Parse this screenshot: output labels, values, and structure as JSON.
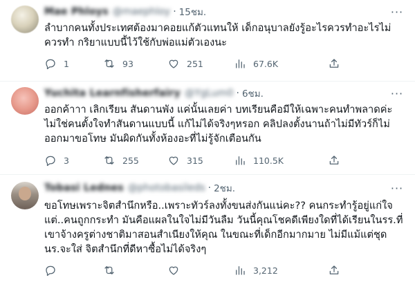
{
  "tweets": [
    {
      "display_name": "Mae Phloys",
      "handle": "@maephloy",
      "time": "15ชม.",
      "text": "ลำบากคนทั้งประเทศต้องมาคอยแก้ตัวแทนให้ เด็กอนุบาลยังรู้อะไรควรทำอะไรไม่ควรทำ กริยาแบบนี้ไว้ใช้กับพ่อแม่ตัวเองนะ",
      "replies": "1",
      "retweets": "93",
      "likes": "251",
      "views": "67.6K"
    },
    {
      "display_name": "Yuchita Learnfisherfairy",
      "handle": "@YgLum0",
      "time": "6ชม.",
      "text": "ออกค้าาา เลิกเรียน สันดานพัง แค่นั้นเลยค่า บทเรียนคือมีให้เฉพาะคนทำพลาดค่ะ ไม่ใช่คนตั้งใจทำสันดานแบบนี้ แก้ไม่ได้จริงๆหรอก คลิปลงตั้งนานถ้าไม่มีทัวร์ก็ไม่ออกมาขอโทษ มันผิดกันทั้งห้องอะที่ไม่รู้จักเตือนกัน",
      "replies": "3",
      "retweets": "255",
      "likes": "315",
      "views": "110.5K"
    },
    {
      "display_name": "Tobasi Lednes",
      "handle": "@photobasileds",
      "time": "2ชม.",
      "text": "ขอโทษเพราะจิตสำนึกหรือ..เพราะทัวร์ลงทั้งขนส่งกันแน่คะ?? คนกระทำรู้อยู่แก่ใจแต่..คนถูกกระทำ มันคือแผลในใจไม่มีวันลืม วันนี้คุณโชคดีเพียงใดที่ได้เรียนในรร.ที่เขาจ้างครูต่างชาติมาสอนสำเนียงให้คุณ ในขณะที่เด็กอีกมากมาย ไม่มีแม้แต่ชุดนร.จะใส่ จิตสำนึกที่ดีหาซื้อไม่ได้จริงๆ",
      "replies": "",
      "retweets": "",
      "likes": "",
      "views": "3,212"
    }
  ],
  "ui": {
    "dot": "·",
    "more": "···"
  },
  "icons": [
    "reply-icon",
    "retweet-icon",
    "like-icon",
    "views-icon",
    "share-icon",
    "more-icon"
  ],
  "colors": {
    "text": "#0f1419",
    "secondary": "#536471",
    "divider": "#eff3f4"
  }
}
